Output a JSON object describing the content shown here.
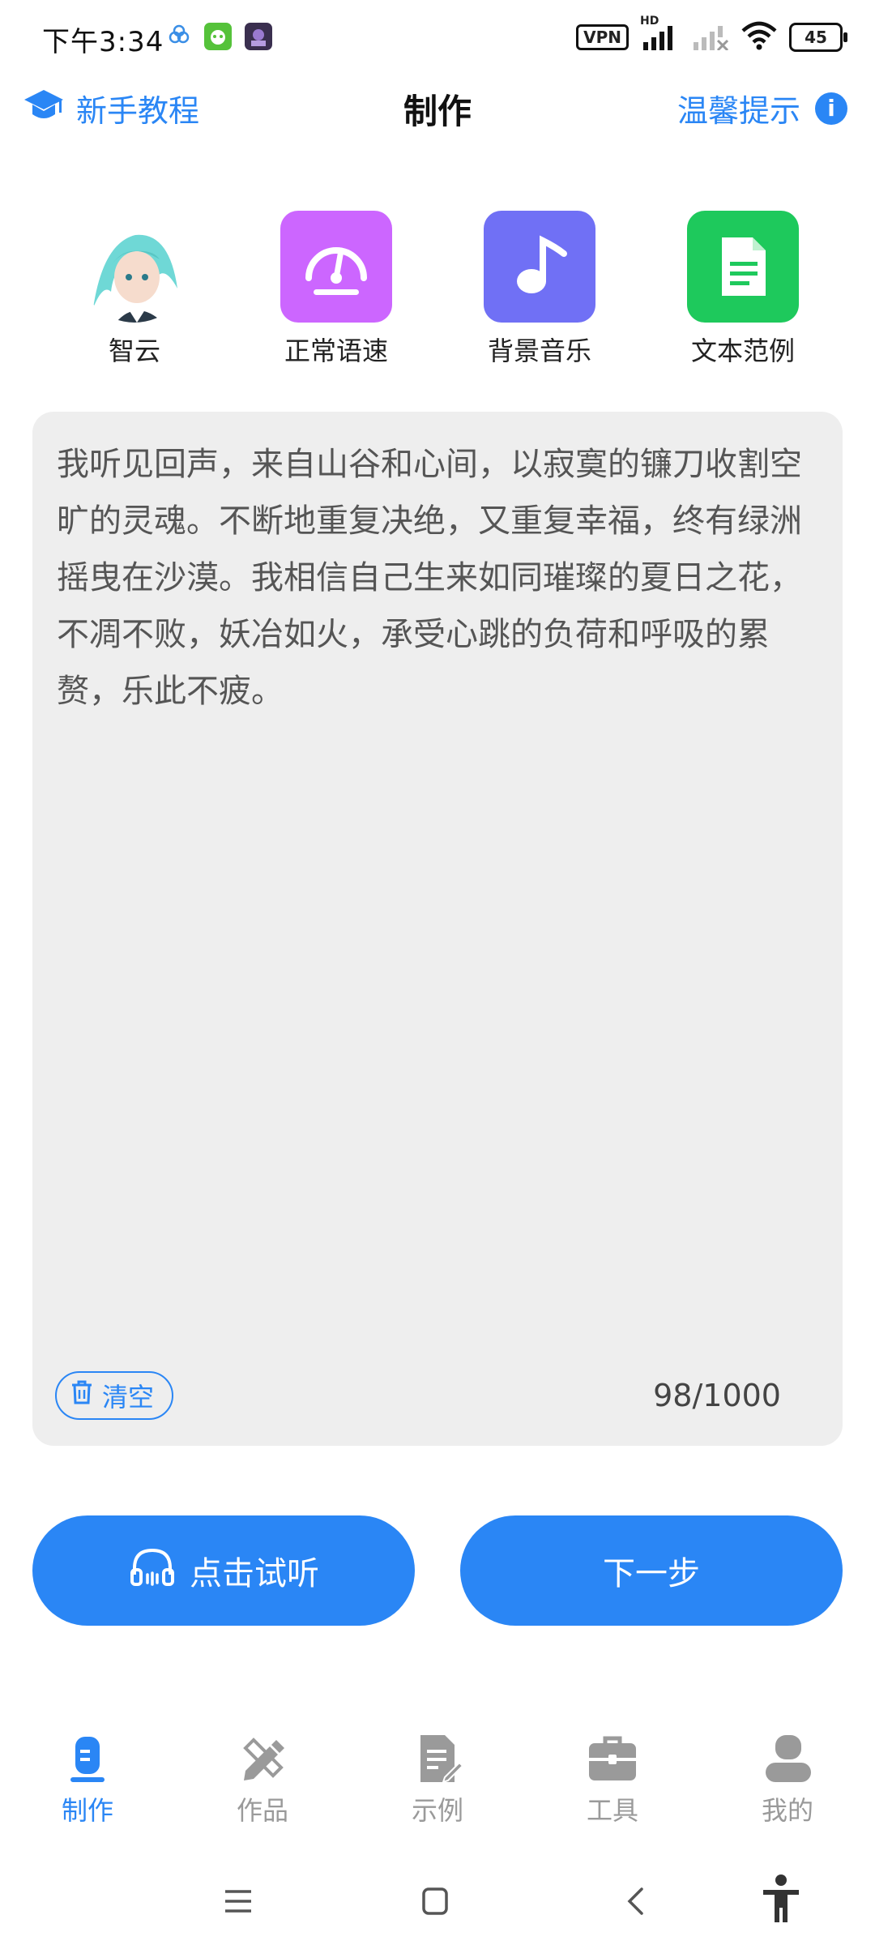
{
  "status_bar": {
    "time": "下午3:34",
    "vpn": "VPN",
    "hd": "HD",
    "battery": "45"
  },
  "header": {
    "tutorial_label": "新手教程",
    "title": "制作",
    "tips_label": "温馨提示",
    "info_glyph": "i"
  },
  "options": [
    {
      "label": "智云",
      "icon": "voice-avatar"
    },
    {
      "label": "正常语速",
      "icon": "speedometer-icon",
      "color": "#cc66ff"
    },
    {
      "label": "背景音乐",
      "icon": "music-note-icon",
      "color": "#7070f5"
    },
    {
      "label": "文本范例",
      "icon": "document-icon",
      "color": "#1ec95c"
    }
  ],
  "editor": {
    "text": "我听见回声，来自山谷和心间，以寂寞的镰刀收割空旷的灵魂。不断地重复决绝，又重复幸福，终有绿洲摇曳在沙漠。我相信自己生来如同璀璨的夏日之花，不凋不败，妖冶如火，承受心跳的负荷和呼吸的累赘，乐此不疲。",
    "clear_label": "清空",
    "count": "98/1000"
  },
  "actions": {
    "preview_label": "点击试听",
    "next_label": "下一步"
  },
  "tabs": [
    {
      "label": "制作",
      "active": true
    },
    {
      "label": "作品",
      "active": false
    },
    {
      "label": "示例",
      "active": false
    },
    {
      "label": "工具",
      "active": false
    },
    {
      "label": "我的",
      "active": false
    }
  ],
  "colors": {
    "accent": "#2a86f5",
    "editor_bg": "#eeeeee",
    "tab_inactive": "#9a9a9a"
  }
}
